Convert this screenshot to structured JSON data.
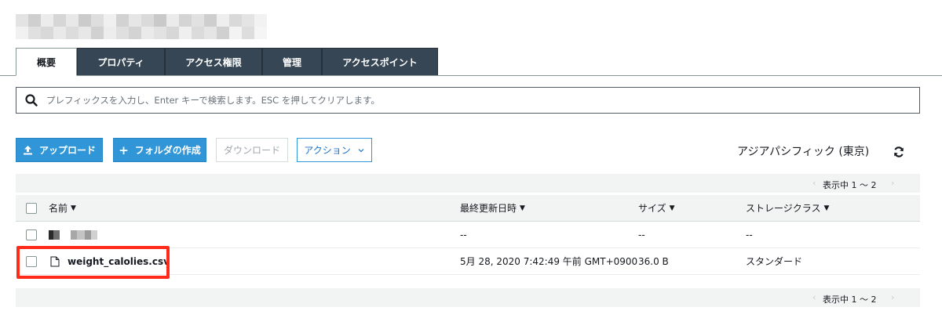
{
  "tabs": [
    {
      "label": "概要",
      "active": true
    },
    {
      "label": "プロパティ",
      "active": false
    },
    {
      "label": "アクセス権限",
      "active": false
    },
    {
      "label": "管理",
      "active": false
    },
    {
      "label": "アクセスポイント",
      "active": false
    }
  ],
  "search": {
    "placeholder": "プレフィックスを入力し、Enter キーで検索します。ESC を押してクリアします。"
  },
  "toolbar": {
    "upload_label": "アップロード",
    "create_folder_label": "フォルダの作成",
    "download_label": "ダウンロード",
    "actions_label": "アクション"
  },
  "region_label": "アジアパシフィック (東京)",
  "pager_text": "表示中 1 〜 2",
  "table": {
    "headers": {
      "name": "名前",
      "last_modified": "最終更新日時",
      "size": "サイズ",
      "storage_class": "ストレージクラス"
    },
    "rows": [
      {
        "name": "",
        "last_modified": "--",
        "size": "--",
        "storage_class": "--",
        "is_folder": true
      },
      {
        "name": "weight_calolies.csv",
        "last_modified": "5月 28, 2020 7:42:49 午前 GMT+0900",
        "size": "36.0 B",
        "storage_class": "スタンダード",
        "is_folder": false
      }
    ]
  },
  "colors": {
    "tab_dark": "#374655",
    "button_blue": "#3096d8",
    "highlight_red": "#ff2a1a"
  }
}
